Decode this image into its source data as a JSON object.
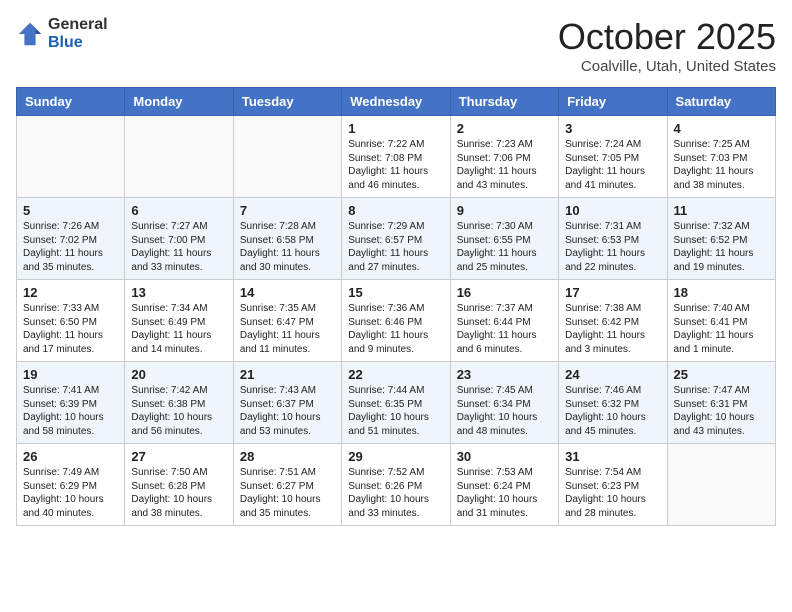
{
  "header": {
    "logo_general": "General",
    "logo_blue": "Blue",
    "month_title": "October 2025",
    "location": "Coalville, Utah, United States"
  },
  "days_of_week": [
    "Sunday",
    "Monday",
    "Tuesday",
    "Wednesday",
    "Thursday",
    "Friday",
    "Saturday"
  ],
  "weeks": [
    [
      {
        "day": "",
        "info": ""
      },
      {
        "day": "",
        "info": ""
      },
      {
        "day": "",
        "info": ""
      },
      {
        "day": "1",
        "info": "Sunrise: 7:22 AM\nSunset: 7:08 PM\nDaylight: 11 hours\nand 46 minutes."
      },
      {
        "day": "2",
        "info": "Sunrise: 7:23 AM\nSunset: 7:06 PM\nDaylight: 11 hours\nand 43 minutes."
      },
      {
        "day": "3",
        "info": "Sunrise: 7:24 AM\nSunset: 7:05 PM\nDaylight: 11 hours\nand 41 minutes."
      },
      {
        "day": "4",
        "info": "Sunrise: 7:25 AM\nSunset: 7:03 PM\nDaylight: 11 hours\nand 38 minutes."
      }
    ],
    [
      {
        "day": "5",
        "info": "Sunrise: 7:26 AM\nSunset: 7:02 PM\nDaylight: 11 hours\nand 35 minutes."
      },
      {
        "day": "6",
        "info": "Sunrise: 7:27 AM\nSunset: 7:00 PM\nDaylight: 11 hours\nand 33 minutes."
      },
      {
        "day": "7",
        "info": "Sunrise: 7:28 AM\nSunset: 6:58 PM\nDaylight: 11 hours\nand 30 minutes."
      },
      {
        "day": "8",
        "info": "Sunrise: 7:29 AM\nSunset: 6:57 PM\nDaylight: 11 hours\nand 27 minutes."
      },
      {
        "day": "9",
        "info": "Sunrise: 7:30 AM\nSunset: 6:55 PM\nDaylight: 11 hours\nand 25 minutes."
      },
      {
        "day": "10",
        "info": "Sunrise: 7:31 AM\nSunset: 6:53 PM\nDaylight: 11 hours\nand 22 minutes."
      },
      {
        "day": "11",
        "info": "Sunrise: 7:32 AM\nSunset: 6:52 PM\nDaylight: 11 hours\nand 19 minutes."
      }
    ],
    [
      {
        "day": "12",
        "info": "Sunrise: 7:33 AM\nSunset: 6:50 PM\nDaylight: 11 hours\nand 17 minutes."
      },
      {
        "day": "13",
        "info": "Sunrise: 7:34 AM\nSunset: 6:49 PM\nDaylight: 11 hours\nand 14 minutes."
      },
      {
        "day": "14",
        "info": "Sunrise: 7:35 AM\nSunset: 6:47 PM\nDaylight: 11 hours\nand 11 minutes."
      },
      {
        "day": "15",
        "info": "Sunrise: 7:36 AM\nSunset: 6:46 PM\nDaylight: 11 hours\nand 9 minutes."
      },
      {
        "day": "16",
        "info": "Sunrise: 7:37 AM\nSunset: 6:44 PM\nDaylight: 11 hours\nand 6 minutes."
      },
      {
        "day": "17",
        "info": "Sunrise: 7:38 AM\nSunset: 6:42 PM\nDaylight: 11 hours\nand 3 minutes."
      },
      {
        "day": "18",
        "info": "Sunrise: 7:40 AM\nSunset: 6:41 PM\nDaylight: 11 hours\nand 1 minute."
      }
    ],
    [
      {
        "day": "19",
        "info": "Sunrise: 7:41 AM\nSunset: 6:39 PM\nDaylight: 10 hours\nand 58 minutes."
      },
      {
        "day": "20",
        "info": "Sunrise: 7:42 AM\nSunset: 6:38 PM\nDaylight: 10 hours\nand 56 minutes."
      },
      {
        "day": "21",
        "info": "Sunrise: 7:43 AM\nSunset: 6:37 PM\nDaylight: 10 hours\nand 53 minutes."
      },
      {
        "day": "22",
        "info": "Sunrise: 7:44 AM\nSunset: 6:35 PM\nDaylight: 10 hours\nand 51 minutes."
      },
      {
        "day": "23",
        "info": "Sunrise: 7:45 AM\nSunset: 6:34 PM\nDaylight: 10 hours\nand 48 minutes."
      },
      {
        "day": "24",
        "info": "Sunrise: 7:46 AM\nSunset: 6:32 PM\nDaylight: 10 hours\nand 45 minutes."
      },
      {
        "day": "25",
        "info": "Sunrise: 7:47 AM\nSunset: 6:31 PM\nDaylight: 10 hours\nand 43 minutes."
      }
    ],
    [
      {
        "day": "26",
        "info": "Sunrise: 7:49 AM\nSunset: 6:29 PM\nDaylight: 10 hours\nand 40 minutes."
      },
      {
        "day": "27",
        "info": "Sunrise: 7:50 AM\nSunset: 6:28 PM\nDaylight: 10 hours\nand 38 minutes."
      },
      {
        "day": "28",
        "info": "Sunrise: 7:51 AM\nSunset: 6:27 PM\nDaylight: 10 hours\nand 35 minutes."
      },
      {
        "day": "29",
        "info": "Sunrise: 7:52 AM\nSunset: 6:26 PM\nDaylight: 10 hours\nand 33 minutes."
      },
      {
        "day": "30",
        "info": "Sunrise: 7:53 AM\nSunset: 6:24 PM\nDaylight: 10 hours\nand 31 minutes."
      },
      {
        "day": "31",
        "info": "Sunrise: 7:54 AM\nSunset: 6:23 PM\nDaylight: 10 hours\nand 28 minutes."
      },
      {
        "day": "",
        "info": ""
      }
    ]
  ]
}
